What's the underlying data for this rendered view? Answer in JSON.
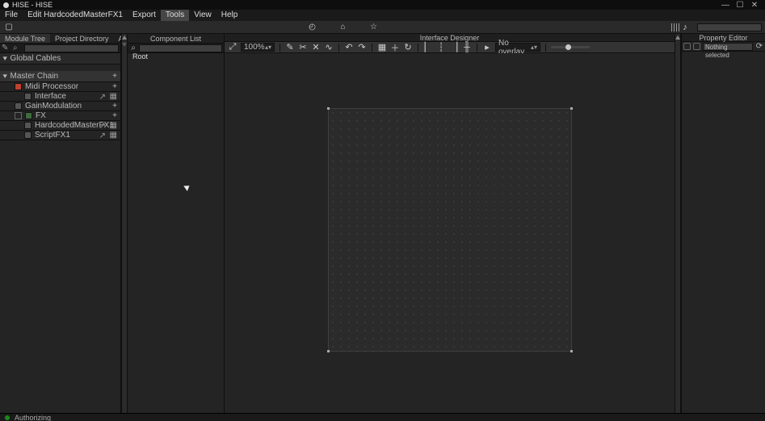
{
  "window": {
    "title": "HISE - HISE",
    "min_icon": "—",
    "max_icon": "☐",
    "close_icon": "✕"
  },
  "menu": {
    "items": [
      "File",
      "Edit HardcodedMasterFX1",
      "Export",
      "Tools",
      "View",
      "Help"
    ],
    "active_index": 3
  },
  "top_icons": {
    "clock": "◴",
    "home": "⌂",
    "star": "☆",
    "meter": "≡",
    "note": "♪"
  },
  "left_panel": {
    "tabs": [
      "Module Tree",
      "Project Directory",
      "API"
    ],
    "active_tab": 0,
    "global_cables": "Global Cables",
    "master_chain": "Master Chain",
    "tree": [
      {
        "label": "Midi Processor",
        "color": "sq-red",
        "indent": 1,
        "plus": true
      },
      {
        "label": "Interface",
        "color": "sq-grey",
        "indent": 2,
        "ext": true,
        "close": true
      },
      {
        "label": "GainModulation",
        "color": "sq-grey",
        "indent": 1,
        "plus": true
      },
      {
        "label": "FX",
        "color": "sq-green",
        "indent": 1,
        "plus": true,
        "chk": true
      },
      {
        "label": "HardcodedMasterFX1",
        "color": "sq-grey",
        "indent": 2,
        "ext": true,
        "close": true
      },
      {
        "label": "ScriptFX1",
        "color": "sq-grey",
        "indent": 2,
        "ext": true,
        "close": true
      }
    ]
  },
  "component_list": {
    "title": "Component List",
    "root": "Root"
  },
  "designer": {
    "title": "Interface Designer",
    "zoom": "100%",
    "overlay": "No overlay"
  },
  "property_editor": {
    "title": "Property Editor",
    "selection": "Nothing selected"
  },
  "statusbar": {
    "text": "Authorizing"
  }
}
